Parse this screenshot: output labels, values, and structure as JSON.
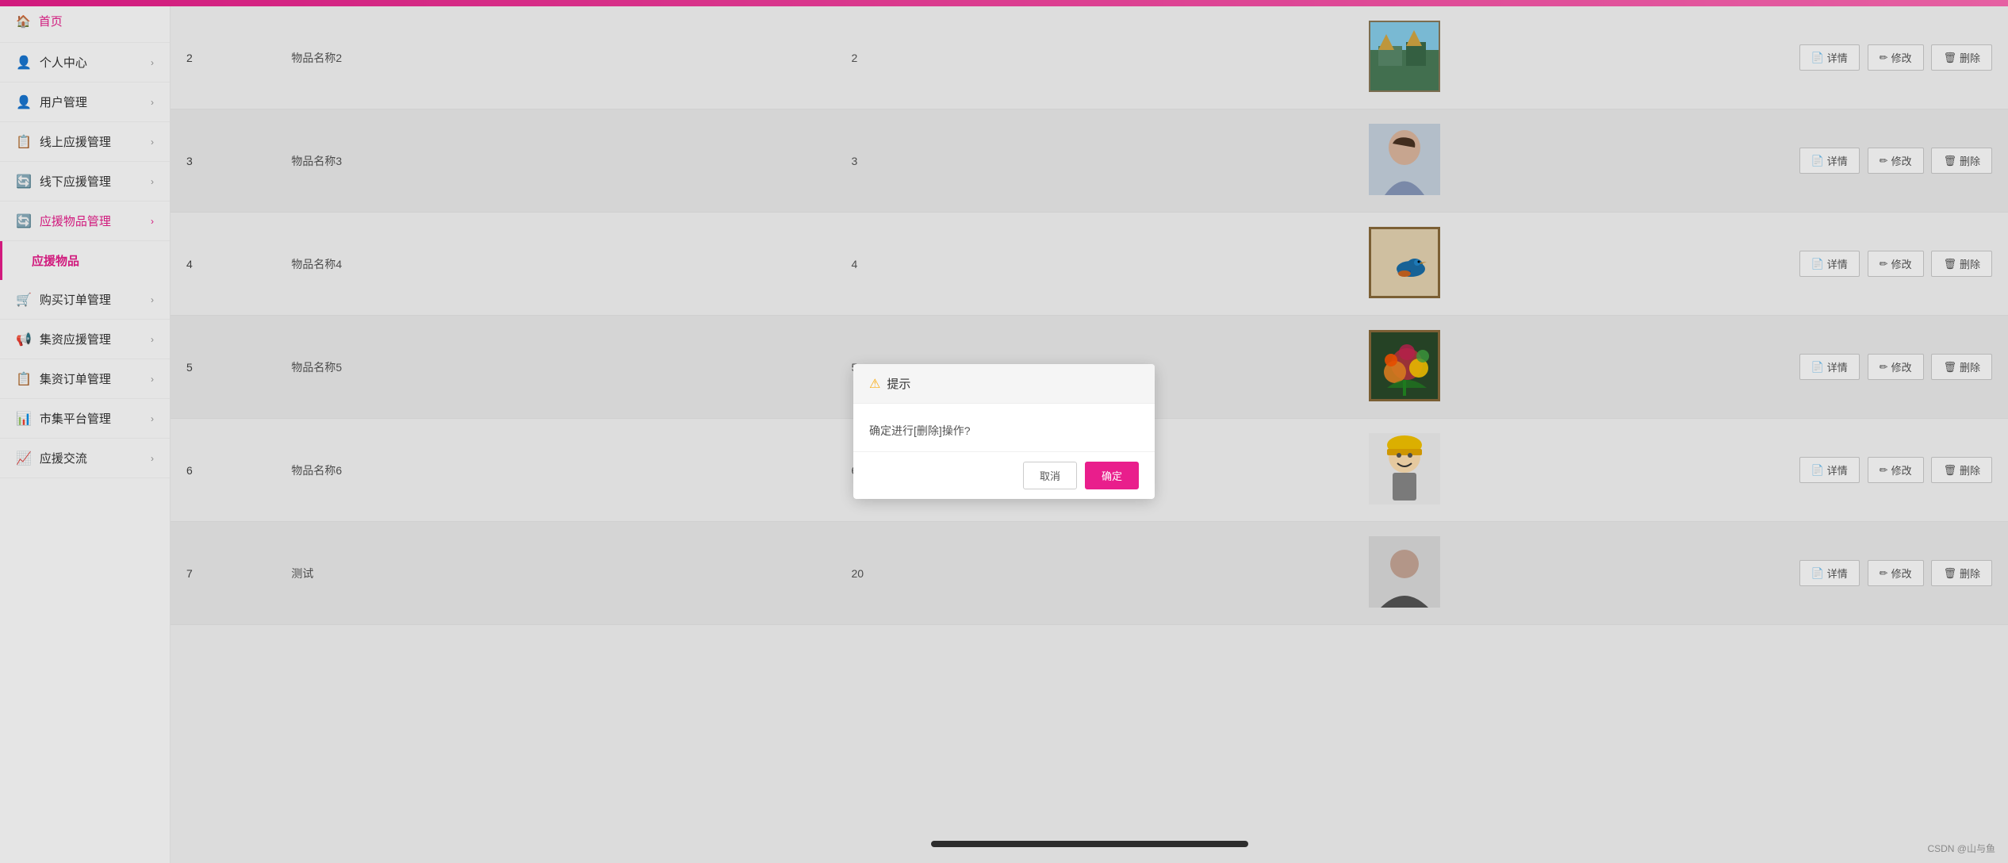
{
  "topbar": {
    "color": "#e91e8c"
  },
  "sidebar": {
    "home_label": "首页",
    "items": [
      {
        "id": "personal",
        "label": "个人中心",
        "icon": "👤",
        "has_arrow": true
      },
      {
        "id": "user-manage",
        "label": "用户管理",
        "icon": "👤",
        "has_arrow": true
      },
      {
        "id": "online-support",
        "label": "线上应援管理",
        "icon": "📋",
        "has_arrow": true
      },
      {
        "id": "offline-support",
        "label": "线下应援管理",
        "icon": "🔄",
        "has_arrow": true
      },
      {
        "id": "support-goods",
        "label": "应援物品管理",
        "icon": "🔄",
        "has_arrow": true,
        "active": true
      },
      {
        "id": "support-goods-sub",
        "label": "应援物品",
        "icon": "",
        "is_sub": true
      },
      {
        "id": "purchase-order",
        "label": "购买订单管理",
        "icon": "🛒",
        "has_arrow": true
      },
      {
        "id": "crowdfund-manage",
        "label": "集资应援管理",
        "icon": "📢",
        "has_arrow": true
      },
      {
        "id": "crowdfund-order",
        "label": "集资订单管理",
        "icon": "📋",
        "has_arrow": true
      },
      {
        "id": "market-manage",
        "label": "市集平台管理",
        "icon": "📊",
        "has_arrow": true
      },
      {
        "id": "support-exchange",
        "label": "应援交流",
        "icon": "📈",
        "has_arrow": true
      }
    ]
  },
  "table": {
    "rows": [
      {
        "num": "2",
        "name": "物品名称2",
        "id": "2",
        "img_type": "landscape",
        "has_border": true
      },
      {
        "num": "3",
        "name": "物品名称3",
        "id": "3",
        "img_type": "portrait",
        "has_border": false
      },
      {
        "num": "4",
        "name": "物品名称4",
        "id": "4",
        "img_type": "bird",
        "has_border": true
      },
      {
        "num": "5",
        "name": "物品名称5",
        "id": "5",
        "img_type": "flowers",
        "has_border": true
      },
      {
        "num": "6",
        "name": "物品名称6",
        "id": "6",
        "img_type": "cartoon",
        "has_border": false
      },
      {
        "num": "7",
        "name": "测试",
        "id": "20",
        "img_type": "person",
        "has_border": false
      }
    ],
    "btn_detail": "详情",
    "btn_edit": "修改",
    "btn_delete": "删除"
  },
  "dialog": {
    "title": "提示",
    "warn_icon": "⚠",
    "message": "确定进行[删除]操作?",
    "btn_cancel": "取消",
    "btn_confirm": "确定"
  },
  "csdn_watermark": "CSDN @山与鱼"
}
